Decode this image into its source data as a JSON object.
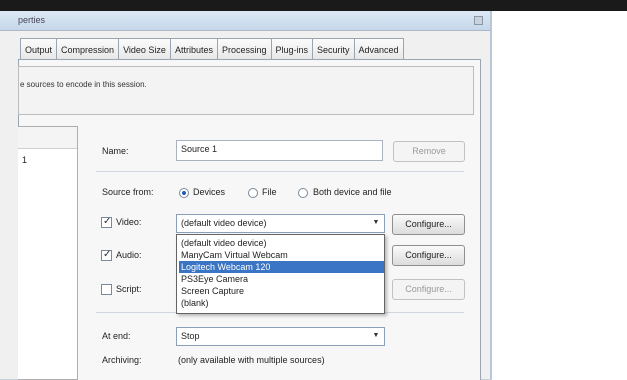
{
  "window": {
    "title": "perties"
  },
  "tabs": [
    "Output",
    "Compression",
    "Video Size",
    "Attributes",
    "Processing",
    "Plug-ins",
    "Security",
    "Advanced"
  ],
  "info_text": "e sources to encode in this session.",
  "source_list": {
    "items": [
      "1"
    ]
  },
  "form": {
    "name_label": "Name:",
    "name_value": "Source 1",
    "remove_label": "Remove",
    "source_from_label": "Source from:",
    "source_from_options": [
      "Devices",
      "File",
      "Both device and file"
    ],
    "source_from_selected": "Devices",
    "video_label": "Video:",
    "video_checked": true,
    "video_value": "(default video device)",
    "audio_label": "Audio:",
    "audio_checked": true,
    "script_label": "Script:",
    "script_checked": false,
    "configure_label": "Configure...",
    "at_end_label": "At end:",
    "at_end_value": "Stop",
    "archiving_label": "Archiving:",
    "archiving_value": "(only available with multiple sources)"
  },
  "video_dropdown": {
    "options": [
      "(default video device)",
      "ManyCam Virtual Webcam",
      "Logitech Webcam 120",
      "PS3Eye Camera",
      "Screen Capture",
      "(blank)"
    ],
    "selected": "Logitech Webcam 120"
  },
  "icons": {
    "dropdown_arrow": "chevron-down-icon",
    "checkmark": "check-icon"
  }
}
